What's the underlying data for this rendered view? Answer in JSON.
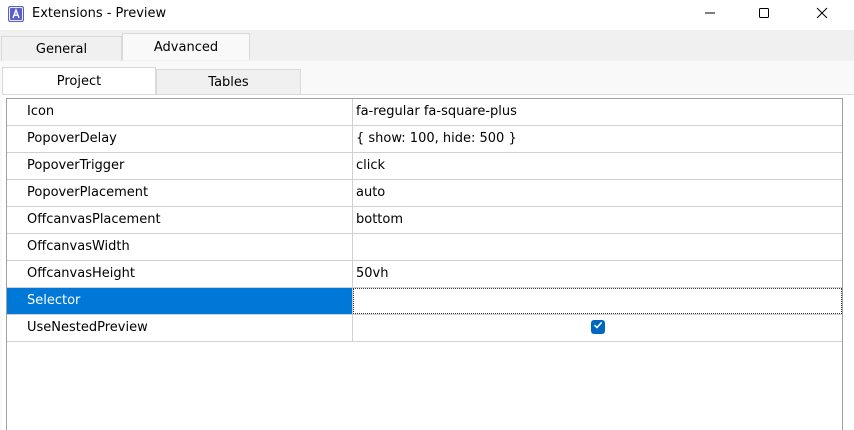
{
  "window": {
    "title": "Extensions - Preview",
    "icon": "app-logo-icon"
  },
  "controls": {
    "minimize": "minimize-icon",
    "maximize": "maximize-icon",
    "close": "close-icon"
  },
  "outer_tabs": [
    {
      "label": "General",
      "active": false
    },
    {
      "label": "Advanced",
      "active": true
    }
  ],
  "inner_tabs": [
    {
      "label": "Project",
      "active": true
    },
    {
      "label": "Tables",
      "active": false
    }
  ],
  "properties": [
    {
      "name": "Icon",
      "value": "fa-regular fa-square-plus"
    },
    {
      "name": "PopoverDelay",
      "value": "{ show: 100, hide: 500 }"
    },
    {
      "name": "PopoverTrigger",
      "value": "click"
    },
    {
      "name": "PopoverPlacement",
      "value": "auto"
    },
    {
      "name": "OffcanvasPlacement",
      "value": "bottom"
    },
    {
      "name": "OffcanvasWidth",
      "value": ""
    },
    {
      "name": "OffcanvasHeight",
      "value": "50vh"
    },
    {
      "name": "Selector",
      "value": "",
      "selected": true
    },
    {
      "name": "UseNestedPreview",
      "value": "",
      "checkbox": true,
      "checked": true
    }
  ],
  "colors": {
    "selection": "#0078d7",
    "checkbox": "#0067c0",
    "app_icon": "#5b5fc7"
  }
}
